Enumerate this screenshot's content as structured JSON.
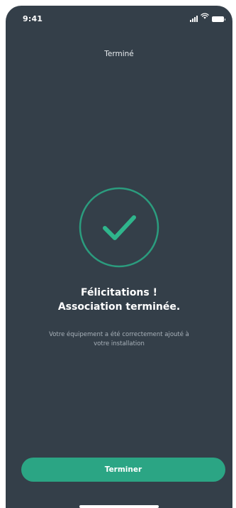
{
  "status_bar": {
    "time": "9:41",
    "signal_icon": "cellular-signal-icon",
    "wifi_icon": "wifi-icon",
    "battery_icon": "battery-icon"
  },
  "header": {
    "title": "Terminé"
  },
  "success": {
    "icon": "checkmark-circle-icon",
    "headline_line1": "Félicitations !",
    "headline_line2": "Association terminée.",
    "description": "Votre équipement a été correctement ajouté à votre installation"
  },
  "actions": {
    "finish_label": "Terminer"
  },
  "colors": {
    "background": "#343f49",
    "accent": "#2ba584",
    "ring": "#2b9c7e",
    "muted_text": "#a9b2ba"
  }
}
